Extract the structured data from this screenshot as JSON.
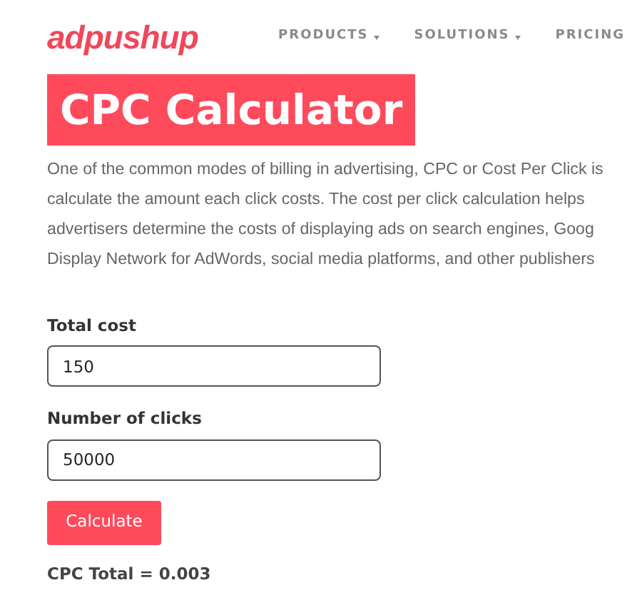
{
  "header": {
    "logo": "adpushup",
    "nav": [
      {
        "label": "PRODUCTS",
        "dropdown": true
      },
      {
        "label": "SOLUTIONS",
        "dropdown": true
      },
      {
        "label": "PRICING",
        "dropdown": false
      }
    ]
  },
  "title": "CPC Calculator",
  "intro_lines": [
    "One of the common modes of billing in advertising, CPC or Cost Per Click is",
    "calculate the amount each click costs. The cost per click calculation helps",
    "advertisers determine the costs of displaying ads on search engines, Goog",
    "Display Network for AdWords, social media platforms, and other publishers"
  ],
  "fields": [
    {
      "label": "Total cost",
      "value": "150"
    },
    {
      "label": "Number of clicks",
      "value": "50000"
    }
  ],
  "button": "Calculate",
  "result": "CPC Total = 0.003"
}
